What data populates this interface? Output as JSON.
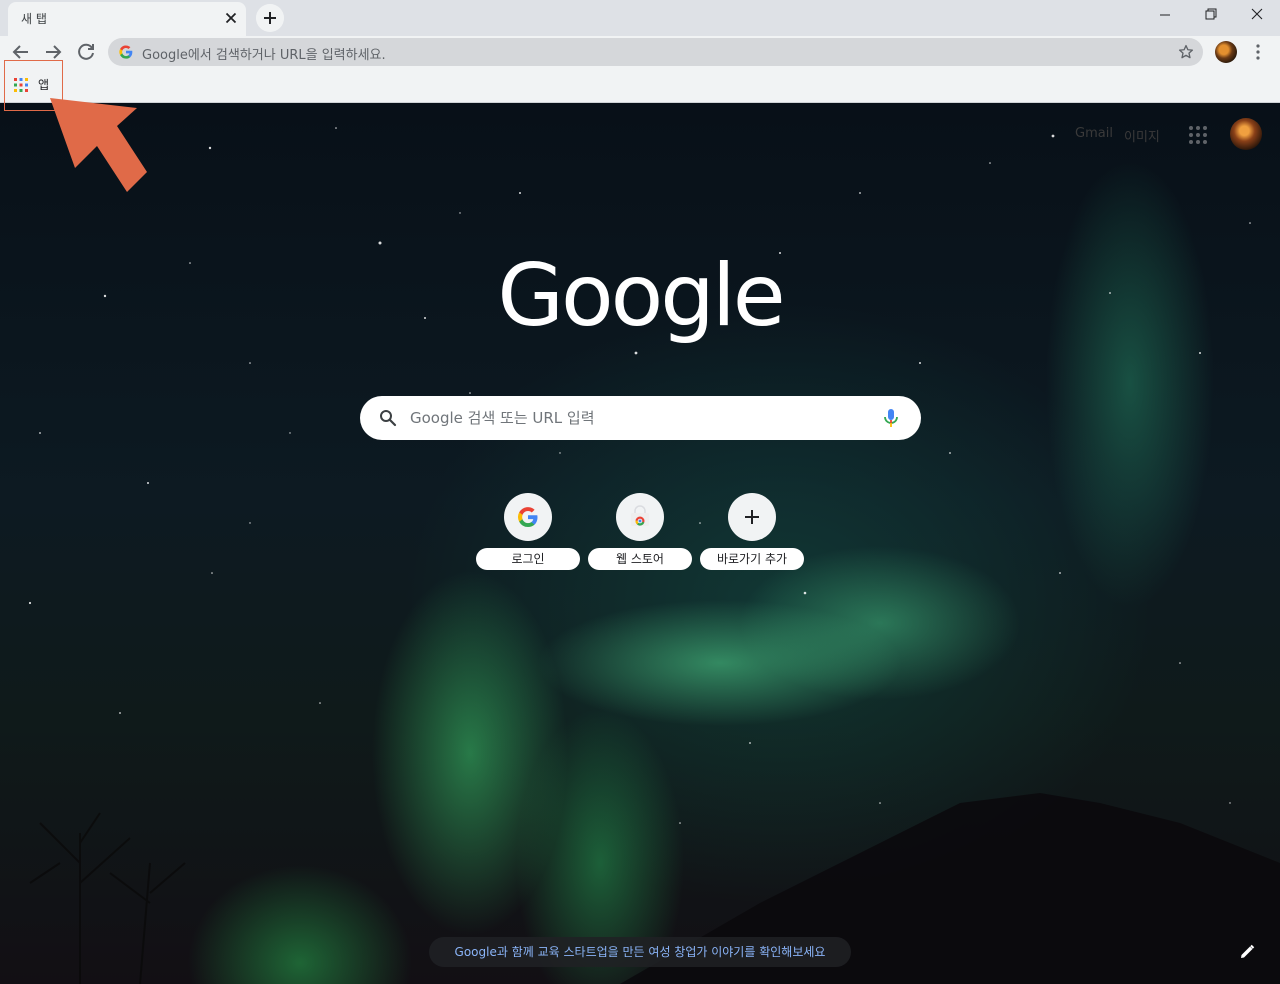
{
  "tab": {
    "title": "새 탭"
  },
  "omnibox": {
    "placeholder": "Google에서 검색하거나 URL을 입력하세요."
  },
  "bookmarks": {
    "apps_label": "앱"
  },
  "ntp": {
    "gmail_link": "Gmail",
    "images_link": "이미지",
    "logo_text": "Google",
    "search_placeholder": "Google 검색 또는 URL 입력",
    "shortcuts": [
      {
        "label": "로그인",
        "icon": "google-g-icon"
      },
      {
        "label": "웹 스토어",
        "icon": "chrome-web-store-icon"
      },
      {
        "label": "바로가기 추가",
        "icon": "plus-icon"
      }
    ],
    "promo_text": "Google과 함께 교육 스타트업을 만든 여성 창업가 이야기를 확인해보세요"
  },
  "colors": {
    "accent_blue": "#4285f4",
    "red": "#ea4335",
    "yellow": "#fbbc05",
    "green": "#34a853",
    "annotation": "#e06a48"
  }
}
